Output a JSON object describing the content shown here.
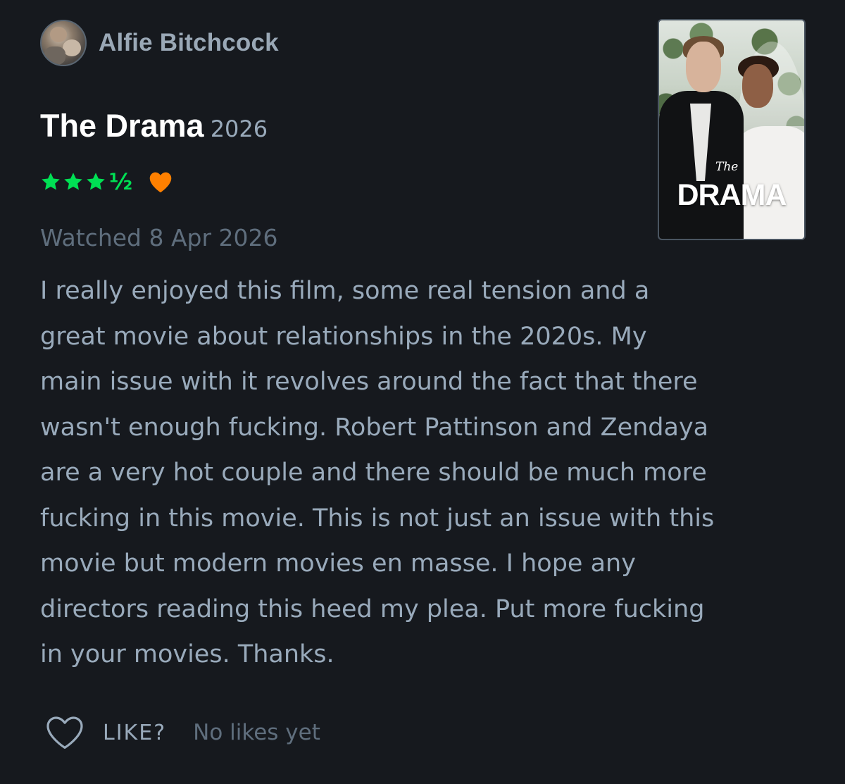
{
  "author": {
    "name": "Alfie Bitchcock"
  },
  "film": {
    "title": "The Drama",
    "year": "2026",
    "poster": {
      "small_text": "The",
      "big_text": "DRAMA"
    }
  },
  "rating": {
    "stars": 3.5,
    "max": 5,
    "half_symbol": "½",
    "liked": true,
    "star_color": "#00e054",
    "heart_color": "#ff8000"
  },
  "watched": "Watched 8 Apr 2026",
  "review": {
    "lines": [
      "I really enjoyed this film, some real tension and a",
      "great movie about relationships in the 2020s. My",
      "main issue with it revolves around the fact that there",
      "wasn't enough fucking. Robert Pattinson and Zendaya",
      "are a very hot couple and there should be much more",
      "fucking in this movie. This is not just an issue with this",
      "movie but modern movies en masse. I hope any",
      "directors reading this heed my plea. Put more fucking",
      "in your movies. Thanks."
    ]
  },
  "footer": {
    "like_label": "LIKE?",
    "likes_count": "No likes yet",
    "like_icon": "heart-outline-icon"
  }
}
